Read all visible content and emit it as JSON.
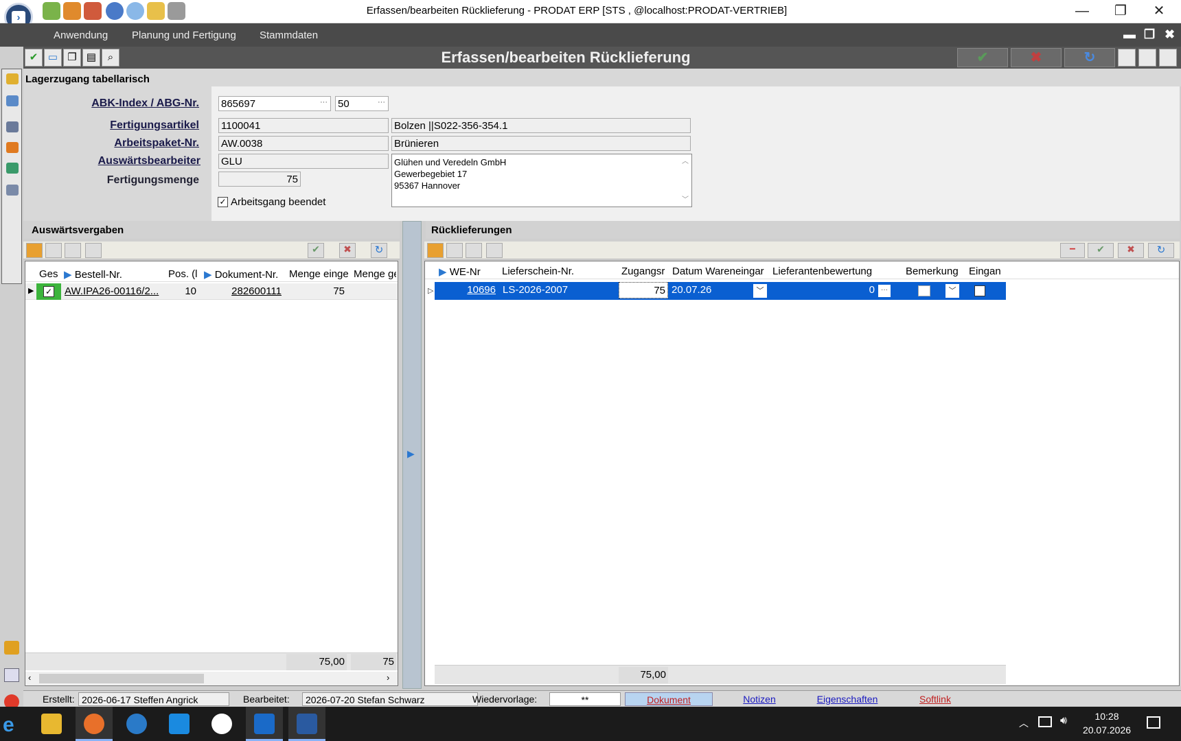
{
  "window": {
    "title": "Erfassen/bearbeiten Rücklieferung - PRODAT ERP   [STS ,  @localhost:PRODAT-VERTRIEB]",
    "minimize": "—",
    "restore": "❐",
    "close": "✕"
  },
  "menu": [
    "Anwendung",
    "Planung und Fertigung",
    "Stammdaten"
  ],
  "mdi": {
    "min": "▬",
    "restore": "❐",
    "close": "✖"
  },
  "toolbar": {
    "title": "Erfassen/bearbeiten Rücklieferung",
    "ok": "✔",
    "cancel": "✖",
    "refresh": "↻"
  },
  "section": {
    "title": "Lagerzugang tabellarisch"
  },
  "form": {
    "abk_label": "ABK-Index / ABG-Nr.",
    "abk_value": "865697",
    "abg_value": "50",
    "dots": "···",
    "artikel_label": "Fertigungsartikel",
    "artikel_value": "1100041",
    "artikel_desc": "Bolzen    ||S022-356-354.1",
    "ap_label": "Arbeitspaket-Nr.",
    "ap_value": "AW.0038",
    "ap_desc": "Brünieren",
    "ab_label": "Auswärtsbearbeiter",
    "ab_value": "GLU",
    "address": [
      "Glühen und Veredeln GmbH",
      "Gewerbegebiet 17",
      "95367 Hannover"
    ],
    "menge_label": "Fertigungsmenge",
    "menge_value": "75",
    "beendet_label": "Arbeitsgang beendet",
    "beendet_checked": true
  },
  "left": {
    "title": "Auswärtsvergaben",
    "columns": [
      "Ges",
      "Bestell-Nr.",
      "Pos. (l",
      "Dokument-Nr.",
      "Menge einge",
      "Menge ge"
    ],
    "row": {
      "checked": true,
      "bestell": "AW.IPA26-00116/2...",
      "pos": "10",
      "dokument": "282600111",
      "menge": "75"
    },
    "footer": [
      "75,00",
      "75"
    ]
  },
  "right": {
    "title": "Rücklieferungen",
    "columns": [
      "WE-Nr",
      "Lieferschein-Nr.",
      "Zugangsr",
      "Datum Wareneingar",
      "Lieferantenbewertung",
      "Bemerkung",
      "Eingan"
    ],
    "row": {
      "we": "10696",
      "ls": "LS-2026-2007",
      "zugang": "75",
      "datum": "20.07.26",
      "bewertung": "0",
      "eingang_checked": false
    },
    "footer": "75,00"
  },
  "status": {
    "erstellt_label": "Erstellt:",
    "erstellt_value": "2026-06-17  Steffen Angrick",
    "bearbeitet_label": "Bearbeitet:",
    "bearbeitet_value": "2026-07-20  Stefan Schwarz",
    "wv_label": "Wiedervorlage:",
    "wv_value": "**",
    "tabs": [
      "Dokument",
      "Notizen",
      "Eigenschaften",
      "Softlink"
    ]
  },
  "taskbar": {
    "time": "10:28",
    "date": "20.07.2026"
  },
  "colors": {
    "selection": "#0a5fd1",
    "accent": "#2b78d0",
    "header_bar": "#555555"
  }
}
